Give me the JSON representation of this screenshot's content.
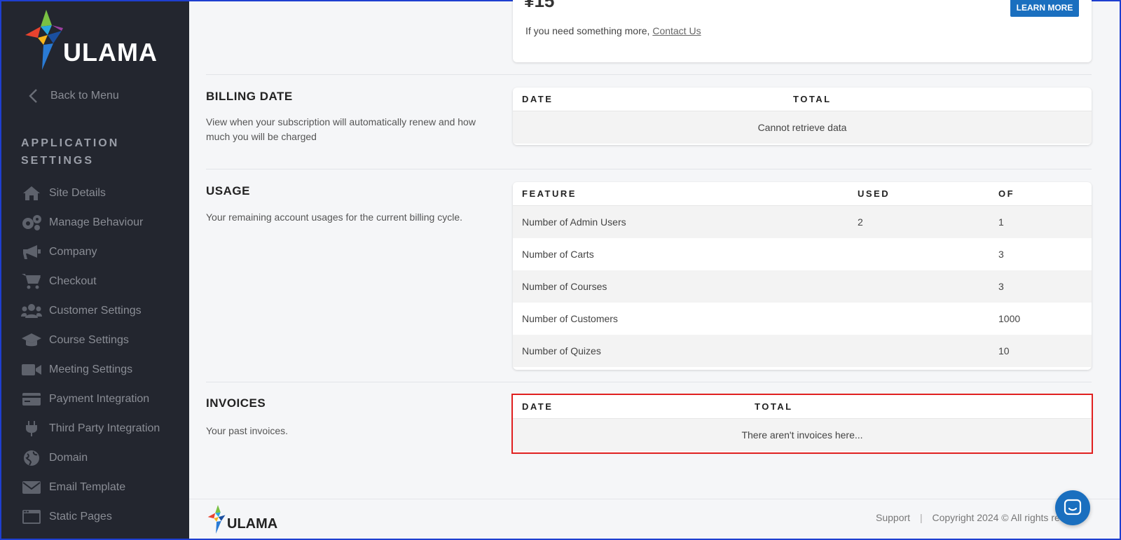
{
  "sidebar": {
    "logo_text": "ULAMA",
    "back_label": "Back to Menu",
    "section_title": "APPLICATION SETTINGS",
    "items": [
      {
        "label": "Site Details",
        "icon": "home-icon"
      },
      {
        "label": "Manage Behaviour",
        "icon": "gears-icon"
      },
      {
        "label": "Company",
        "icon": "megaphone-icon"
      },
      {
        "label": "Checkout",
        "icon": "cart-icon"
      },
      {
        "label": "Customer Settings",
        "icon": "users-icon"
      },
      {
        "label": "Course Settings",
        "icon": "graduation-cap-icon"
      },
      {
        "label": "Meeting Settings",
        "icon": "video-camera-icon"
      },
      {
        "label": "Payment Integration",
        "icon": "credit-card-icon"
      },
      {
        "label": "Third Party Integration",
        "icon": "plug-icon"
      },
      {
        "label": "Domain",
        "icon": "globe-icon"
      },
      {
        "label": "Email Template",
        "icon": "envelope-icon"
      },
      {
        "label": "Static Pages",
        "icon": "window-icon"
      }
    ]
  },
  "plan_card": {
    "price_partial": "¥15",
    "more_text": "If you need something more, ",
    "contact_link": "Contact Us",
    "learn_more": "LEARN MORE"
  },
  "billing": {
    "title": "BILLING DATE",
    "description": "View when your subscription will automatically renew and how much you will be charged",
    "col_date": "DATE",
    "col_total": "TOTAL",
    "empty": "Cannot retrieve data"
  },
  "usage": {
    "title": "USAGE",
    "description": "Your remaining account usages for the current billing cycle.",
    "col_feature": "FEATURE",
    "col_used": "USED",
    "col_of": "OF",
    "rows": [
      {
        "feature": "Number of Admin Users",
        "used": "2",
        "of": "1"
      },
      {
        "feature": "Number of Carts",
        "used": "",
        "of": "3"
      },
      {
        "feature": "Number of Courses",
        "used": "",
        "of": "3"
      },
      {
        "feature": "Number of Customers",
        "used": "",
        "of": "1000"
      },
      {
        "feature": "Number of Quizes",
        "used": "",
        "of": "10"
      }
    ]
  },
  "invoices": {
    "title": "INVOICES",
    "description": "Your past invoices.",
    "col_date": "DATE",
    "col_total": "TOTAL",
    "empty": "There aren't invoices here..."
  },
  "footer": {
    "logo_text": "ULAMA",
    "support": "Support",
    "separator": "|",
    "copyright": "Copyright 2024 © All rights re"
  },
  "colors": {
    "sidebar_bg": "#23262f",
    "accent": "#1a6fbf",
    "highlight": "#e02020"
  }
}
